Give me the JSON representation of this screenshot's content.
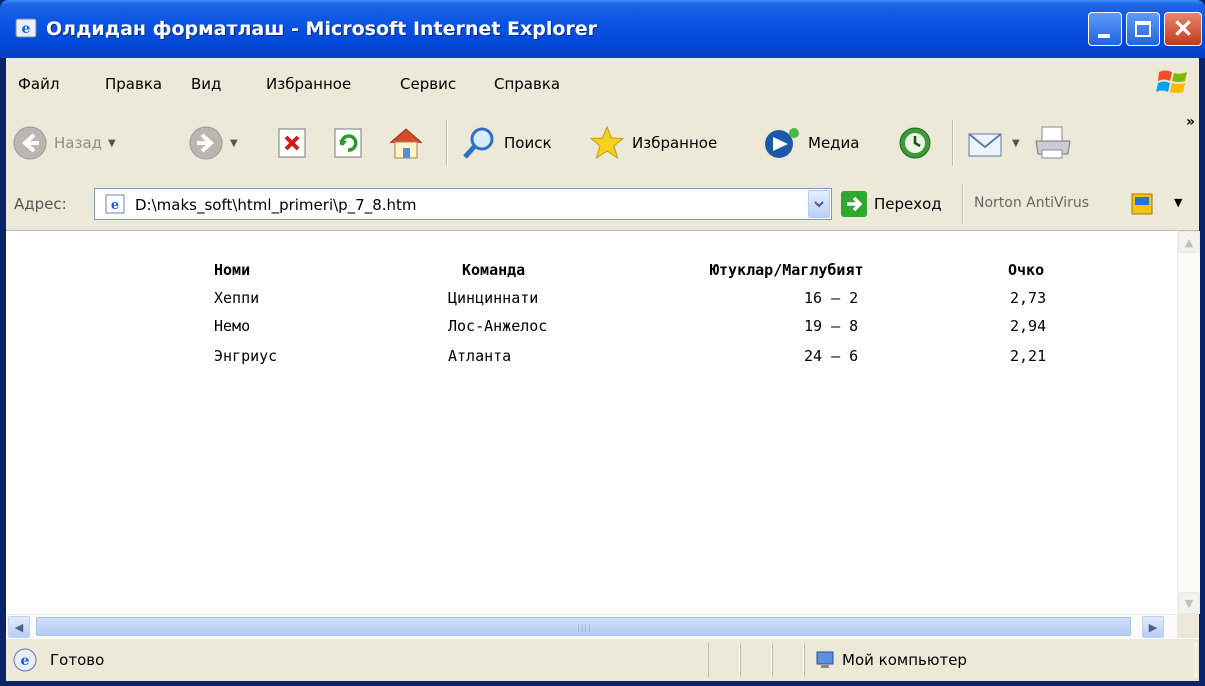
{
  "window": {
    "title": "Олдидан форматлаш - Microsoft Internet Explorer"
  },
  "menu": [
    "Файл",
    "Правка",
    "Вид",
    "Избранное",
    "Сервис",
    "Справка"
  ],
  "toolbar": {
    "back_label": "Назад",
    "search_label": "Поиск",
    "favorites_label": "Избранное",
    "media_label": "Медиа"
  },
  "address": {
    "label": "Адрес:",
    "value": "D:\\maks_soft\\html_primeri\\p_7_8.htm",
    "go_label": "Переход",
    "norton_label": "Norton AntiVirus"
  },
  "table": {
    "headers": [
      "Номи",
      "Команда",
      "Ютуклар/Маглубият",
      "Очко"
    ],
    "rows": [
      {
        "name": "Хеппи",
        "team": "Цинциннати",
        "record": "16 – 2",
        "points": "2,73"
      },
      {
        "name": "Немо",
        "team": "Лос-Анжелос",
        "record": "19 – 8",
        "points": "2,94"
      },
      {
        "name": "Энгриус",
        "team": "Атланта",
        "record": "24 – 6",
        "points": "2,21"
      }
    ]
  },
  "status": {
    "text": "Готово",
    "zone": "Мой компьютер"
  }
}
